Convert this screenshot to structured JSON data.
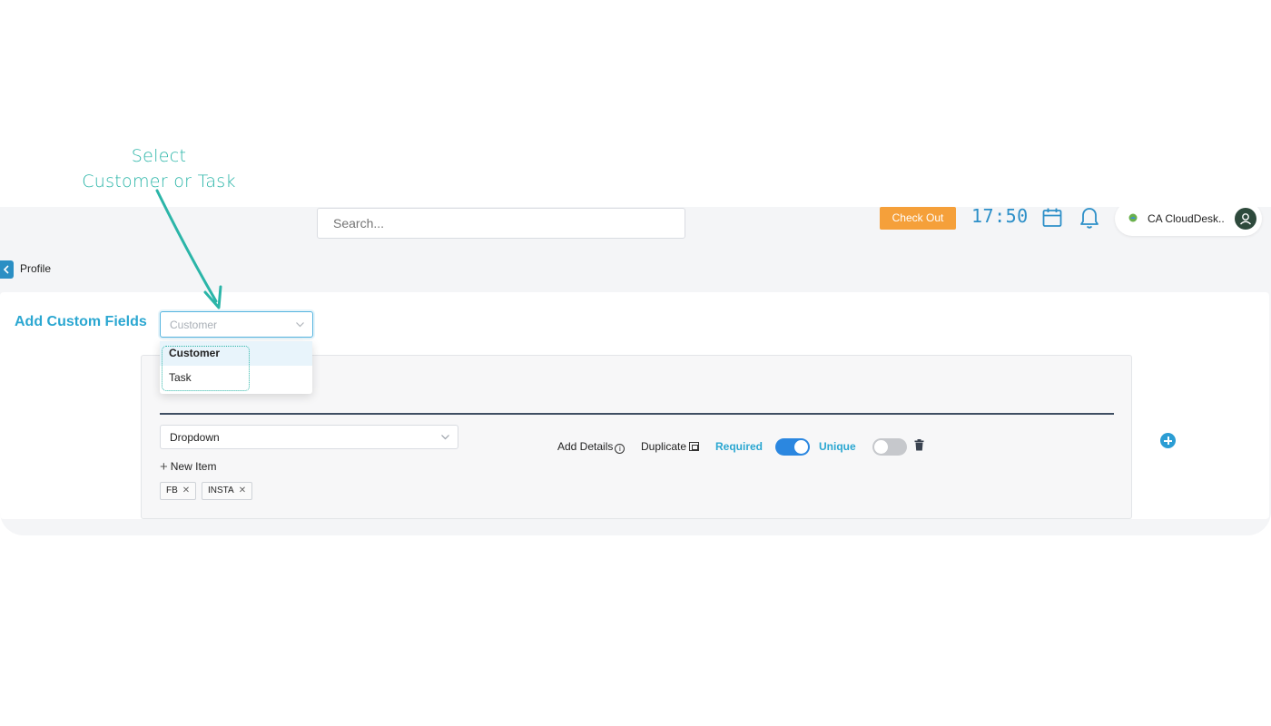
{
  "annotation": {
    "line1": "Select",
    "line2": "Customer or Task"
  },
  "header": {
    "search_placeholder": "Search...",
    "checkout_label": "Check Out",
    "clock": "17:50",
    "org_name": "CA CloudDesk..",
    "icons": [
      "calendar-icon",
      "bell-icon",
      "user-icon"
    ]
  },
  "breadcrumb": {
    "label": "Profile"
  },
  "custom_fields": {
    "title": "Add Custom Fields",
    "type_select": {
      "placeholder": "Customer"
    },
    "options": [
      "Customer",
      "Task"
    ],
    "selected_option": "Customer",
    "field": {
      "type": "Dropdown",
      "new_item_label": "New Item",
      "items": [
        "FB",
        "INSTA"
      ],
      "add_details_label": "Add Details",
      "duplicate_label": "Duplicate",
      "required_label": "Required",
      "required_on": true,
      "unique_label": "Unique",
      "unique_on": false
    }
  },
  "colors": {
    "accent": "#2ba7d1",
    "annotation": "#2bb5a8",
    "checkout": "#f5a03a",
    "toggle_on": "#2b87e0"
  }
}
